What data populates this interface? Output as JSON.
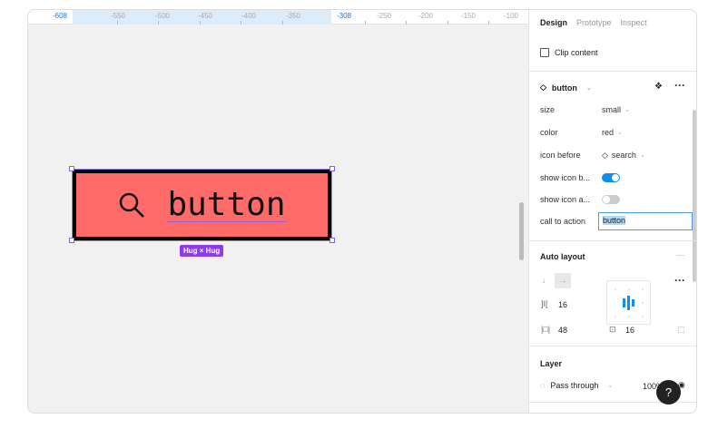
{
  "ruler": {
    "labels": [
      "-608",
      "-550",
      "-500",
      "-450",
      "-400",
      "-350",
      "-308",
      "-250",
      "-200",
      "-150",
      "-100"
    ]
  },
  "canvas": {
    "button_label": "button",
    "hug_badge": "Hug × Hug"
  },
  "panel": {
    "tabs": [
      "Design",
      "Prototype",
      "Inspect"
    ],
    "clip_content": "Clip content",
    "component": {
      "name": "button"
    },
    "props": [
      {
        "key": "size",
        "value": "small"
      },
      {
        "key": "color",
        "value": "red"
      },
      {
        "key": "icon before",
        "value": "search"
      },
      {
        "key": "show icon b...",
        "value": true
      },
      {
        "key": "show icon a...",
        "value": false
      },
      {
        "key": "call to action",
        "value": "button"
      }
    ],
    "auto_layout": {
      "title": "Auto layout",
      "gap": "16",
      "padding_h": "48",
      "padding_v": "16"
    },
    "layer": {
      "title": "Layer",
      "blend": "Pass through",
      "opacity": "100%"
    },
    "help": "?"
  },
  "colors": {
    "accent": "#0d99ff",
    "button_fill": "#ff6b68",
    "selection": "#8b5cf6"
  }
}
